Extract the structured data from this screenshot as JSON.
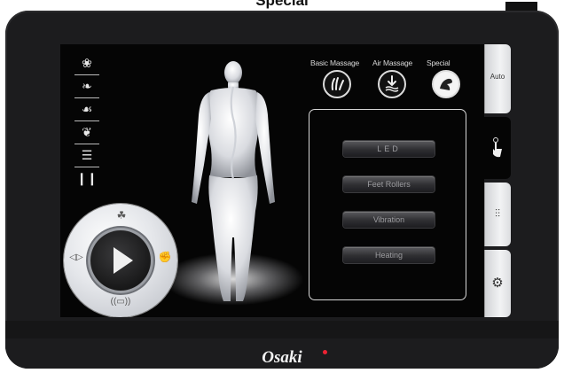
{
  "heading": "Special",
  "brand": {
    "name": "Osaki",
    "accent_color": "#e02233"
  },
  "top_tabs": [
    {
      "label": "Basic Massage",
      "icon": "hands-massage-icon"
    },
    {
      "label": "Air Massage",
      "icon": "air-down-arrow-icon"
    },
    {
      "label": "Special",
      "icon": "special-hand-icon",
      "active": true
    }
  ],
  "left_icons": [
    "hands-kneading-icon",
    "hands-tapping-icon",
    "hands-shiatsu-icon",
    "hands-rolling-icon",
    "hand-flat-icon",
    "feet-icon"
  ],
  "panel_buttons": [
    "LED",
    "Feet Rollers",
    "Vibration",
    "Heating"
  ],
  "side_tabs": [
    {
      "label": "Auto",
      "icon": "auto-icon"
    },
    {
      "label": "",
      "icon": "touch-hand-icon",
      "active": true
    },
    {
      "label": "",
      "icon": "sliders-icon"
    },
    {
      "label": "",
      "icon": "gear-icon"
    }
  ],
  "dial": {
    "center_icon": "play-icon"
  },
  "colors": {
    "device": "#1c1c1e",
    "screen": "#050505",
    "panel_border": "#d7d7d7"
  }
}
